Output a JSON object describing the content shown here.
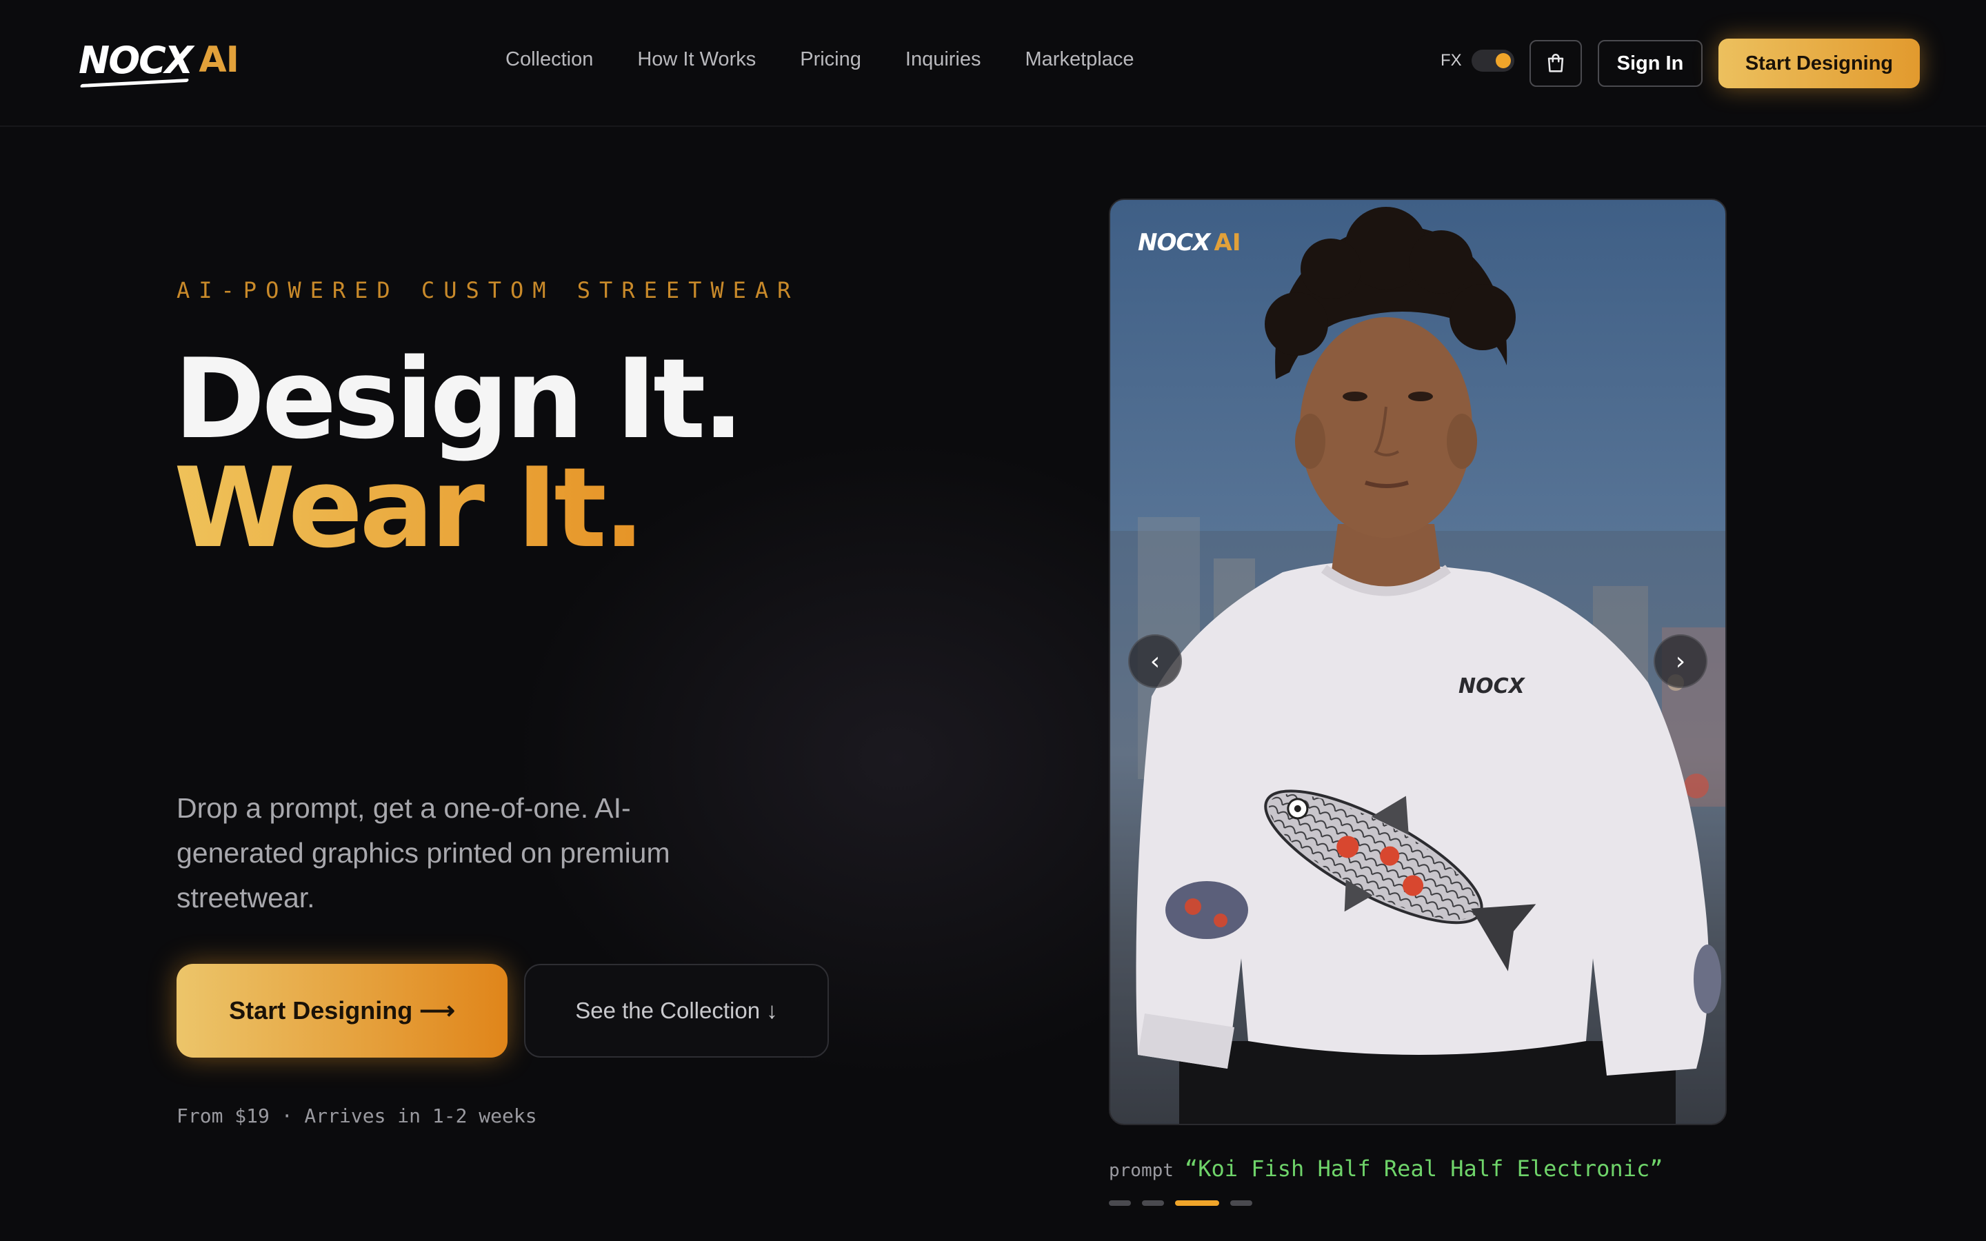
{
  "brand": {
    "name": "NOCX",
    "suffix": "AI"
  },
  "nav": {
    "links": [
      "Collection",
      "How It Works",
      "Pricing",
      "Inquiries",
      "Marketplace"
    ],
    "fx_label": "FX",
    "fx_enabled": true,
    "cart_icon": "shopping-bag-icon",
    "sign_in": "Sign In",
    "start_designing": "Start Designing"
  },
  "hero": {
    "eyebrow": "AI-POWERED CUSTOM STREETWEAR",
    "headline_line1": "Design It.",
    "headline_line2": "Wear It.",
    "lead": "Drop a prompt, get a one-of-one. AI-generated graphics printed on premium streetwear.",
    "cta_primary": "Start Designing ⟶",
    "cta_secondary": "See the Collection ↓",
    "meta": "From $19 · Arrives in 1-2 weeks"
  },
  "carousel": {
    "prev_icon": "‹",
    "next_icon": "›",
    "prompt_label": "prompt",
    "prompt_text": "“Koi Fish Half Real Half Electronic”",
    "slide_count": 4,
    "active_index": 2,
    "shirt_logo": "NOCX"
  },
  "colors": {
    "accent_start": "#ecc05e",
    "accent_end": "#e29a2e",
    "background": "#0b0b0d",
    "prompt_green": "#6fd46a"
  }
}
